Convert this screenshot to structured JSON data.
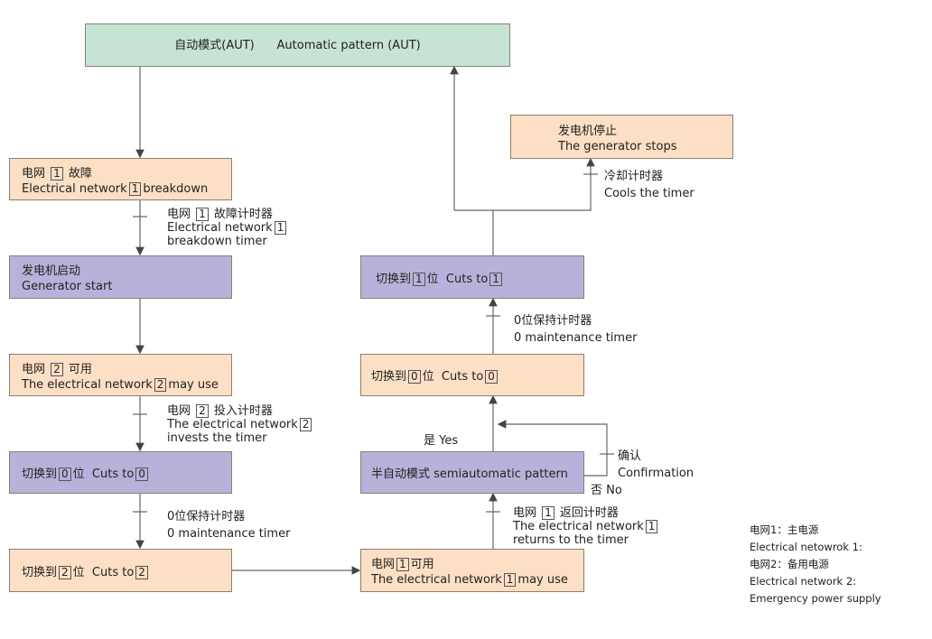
{
  "colors": {
    "green": "#c6e4d4",
    "peach": "#fcdfc4",
    "purple": "#b8b2da",
    "line": "#555555"
  },
  "nodes": {
    "aut": {
      "color": "green",
      "lines": [
        [
          {
            "t": "自动模式(AUT)      Automatic pattern (AUT)"
          }
        ]
      ]
    },
    "net1_fault": {
      "color": "peach",
      "lines": [
        [
          {
            "t": "电网 "
          },
          {
            "b": "1"
          },
          {
            "t": " 故障"
          }
        ],
        [
          {
            "t": "Electrical network"
          },
          {
            "b": "1"
          },
          {
            "t": "breakdown"
          }
        ]
      ]
    },
    "gen_start": {
      "color": "purple",
      "lines": [
        [
          {
            "t": "发电机启动"
          }
        ],
        [
          {
            "t": "Generator start"
          }
        ]
      ]
    },
    "net2_usable": {
      "color": "peach",
      "lines": [
        [
          {
            "t": "电网 "
          },
          {
            "b": "2"
          },
          {
            "t": " 可用"
          }
        ],
        [
          {
            "t": "The electrical network"
          },
          {
            "b": "2"
          },
          {
            "t": "may use"
          }
        ]
      ]
    },
    "cut0_left": {
      "color": "purple",
      "lines": [
        [
          {
            "t": "切换到"
          },
          {
            "b": "0"
          },
          {
            "t": "位  Cuts to"
          },
          {
            "b": "0"
          }
        ]
      ]
    },
    "cut2": {
      "color": "peach",
      "lines": [
        [
          {
            "t": "切换到"
          },
          {
            "b": "2"
          },
          {
            "t": "位  Cuts to"
          },
          {
            "b": "2"
          }
        ]
      ]
    },
    "net1_usable": {
      "color": "peach",
      "lines": [
        [
          {
            "t": "电网"
          },
          {
            "b": "1"
          },
          {
            "t": "可用"
          }
        ],
        [
          {
            "t": "The electrical network"
          },
          {
            "b": "1"
          },
          {
            "t": "may use"
          }
        ]
      ]
    },
    "semi": {
      "color": "purple",
      "lines": [
        [
          {
            "t": "半自动模式 semiautomatic pattern"
          }
        ]
      ]
    },
    "cut0_right": {
      "color": "peach",
      "lines": [
        [
          {
            "t": "切换到"
          },
          {
            "b": "0"
          },
          {
            "t": "位  Cuts to"
          },
          {
            "b": "0"
          }
        ]
      ]
    },
    "cut1": {
      "color": "purple",
      "lines": [
        [
          {
            "t": "切换到"
          },
          {
            "b": "1"
          },
          {
            "t": "位  Cuts to"
          },
          {
            "b": "1"
          }
        ]
      ]
    },
    "gen_stop": {
      "color": "peach",
      "lines": [
        [
          {
            "t": "发电机停止"
          }
        ],
        [
          {
            "t": "The generator stops"
          }
        ]
      ]
    }
  },
  "labels": {
    "t_fault": [
      [
        {
          "t": "电网 "
        },
        {
          "b": "1"
        },
        {
          "t": " 故障计时器"
        }
      ],
      [
        {
          "t": "Electrical network"
        },
        {
          "b": "1"
        }
      ],
      [
        {
          "t": "breakdown timer"
        }
      ]
    ],
    "t_invest": [
      [
        {
          "t": "电网 "
        },
        {
          "b": "2"
        },
        {
          "t": " 投入计时器"
        }
      ],
      [
        {
          "t": "The electrical network"
        },
        {
          "b": "2"
        }
      ],
      [
        {
          "t": "invests the timer"
        }
      ]
    ],
    "t_maint_left": [
      [
        {
          "t": "0位保持计时器"
        }
      ],
      [
        {
          "t": "0 maintenance timer"
        }
      ]
    ],
    "t_return": [
      [
        {
          "t": "电网 "
        },
        {
          "b": "1"
        },
        {
          "t": " 返回计时器"
        }
      ],
      [
        {
          "t": "The electrical network"
        },
        {
          "b": "1"
        }
      ],
      [
        {
          "t": "returns to the timer"
        }
      ]
    ],
    "t_maint_right": [
      [
        {
          "t": "0位保持计时器"
        }
      ],
      [
        {
          "t": "0 maintenance timer"
        }
      ]
    ],
    "t_cool": [
      [
        {
          "t": "冷却计时器"
        }
      ],
      [
        {
          "t": "Cools the timer"
        }
      ]
    ],
    "t_confirm": [
      [
        {
          "t": "确认"
        }
      ],
      [
        {
          "t": "Confirmation"
        }
      ]
    ],
    "yes": [
      [
        {
          "t": "是 Yes"
        }
      ]
    ],
    "no": [
      [
        {
          "t": "否 No"
        }
      ]
    ]
  },
  "legend": [
    "电网1：主电源",
    "Electrical netowrok 1:",
    "电网2：备用电源",
    "Electrical network 2:",
    "Emergency power supply"
  ]
}
